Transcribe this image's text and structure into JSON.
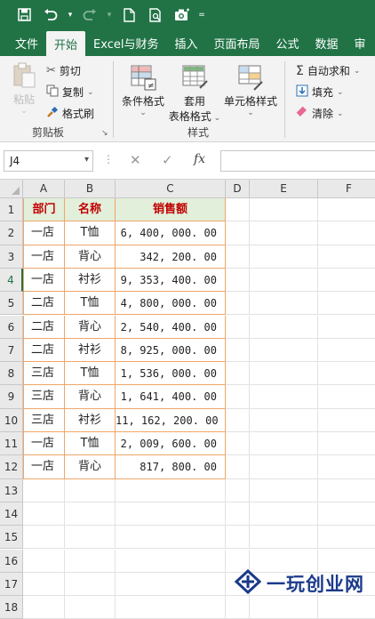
{
  "colors": {
    "accent": "#217346",
    "header_fill": "#e2efda",
    "header_text": "#c00000",
    "table_border": "#f0a66a"
  },
  "qat": {
    "icons": [
      "save-icon",
      "undo-icon",
      "redo-icon",
      "new-file-icon",
      "print-preview-icon",
      "camera-icon",
      "customize-icon"
    ]
  },
  "tabs": [
    "文件",
    "开始",
    "Excel与财务",
    "插入",
    "页面布局",
    "公式",
    "数据",
    "审"
  ],
  "ribbon": {
    "clipboard": {
      "paste": "粘贴",
      "cut": "剪切",
      "copy": "复制",
      "format_painter": "格式刷",
      "label": "剪贴板"
    },
    "styles": {
      "conditional": "条件格式",
      "table_format_1": "套用",
      "table_format_2": "表格格式",
      "cell_styles": "单元格样式",
      "label": "样式"
    },
    "editing": {
      "autosum": "自动求和",
      "fill": "填充",
      "clear": "清除"
    }
  },
  "formula_bar": {
    "name_box": "J4",
    "fx": "fx",
    "value": ""
  },
  "columns": [
    "A",
    "B",
    "C",
    "D",
    "E",
    "F"
  ],
  "rows": [
    "1",
    "2",
    "3",
    "4",
    "5",
    "6",
    "7",
    "8",
    "9",
    "10",
    "11",
    "12",
    "13",
    "14",
    "15",
    "16",
    "17",
    "18"
  ],
  "table": {
    "headers": [
      "部门",
      "名称",
      "销售额"
    ],
    "rows": [
      [
        "一店",
        "T恤",
        "6, 400, 000. 00"
      ],
      [
        "一店",
        "背心",
        "342, 200. 00"
      ],
      [
        "一店",
        "衬衫",
        "9, 353, 400. 00"
      ],
      [
        "二店",
        "T恤",
        "4, 800, 000. 00"
      ],
      [
        "二店",
        "背心",
        "2, 540, 400. 00"
      ],
      [
        "二店",
        "衬衫",
        "8, 925, 000. 00"
      ],
      [
        "三店",
        "T恤",
        "1, 536, 000. 00"
      ],
      [
        "三店",
        "背心",
        "1, 641, 400. 00"
      ],
      [
        "三店",
        "衬衫",
        "11, 162, 200. 00"
      ],
      [
        "一店",
        "T恤",
        "2, 009, 600. 00"
      ],
      [
        "一店",
        "背心",
        "817, 800. 00"
      ]
    ]
  },
  "watermark": {
    "text": "一玩创业网",
    "logo": "watermark-logo-icon"
  }
}
